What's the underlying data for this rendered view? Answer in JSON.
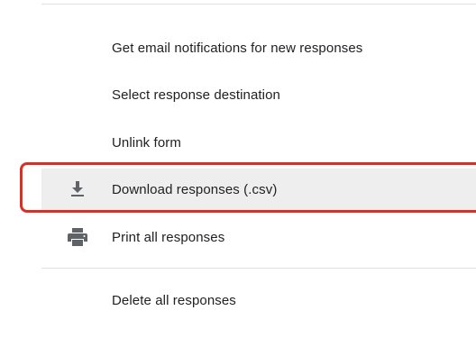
{
  "menu": {
    "items": [
      {
        "label": "Get email notifications for new responses",
        "icon": ""
      },
      {
        "label": "Select response destination",
        "icon": ""
      },
      {
        "label": "Unlink form",
        "icon": ""
      },
      {
        "label": "Download responses (.csv)",
        "icon": "download-icon"
      },
      {
        "label": "Print all responses",
        "icon": "print-icon"
      },
      {
        "label": "Delete all responses",
        "icon": ""
      }
    ]
  },
  "colors": {
    "text": "#202124",
    "icon": "#5f6368",
    "hover_bg": "#eeeeee",
    "divider": "#e0e0e0",
    "highlight": "#d93025"
  }
}
